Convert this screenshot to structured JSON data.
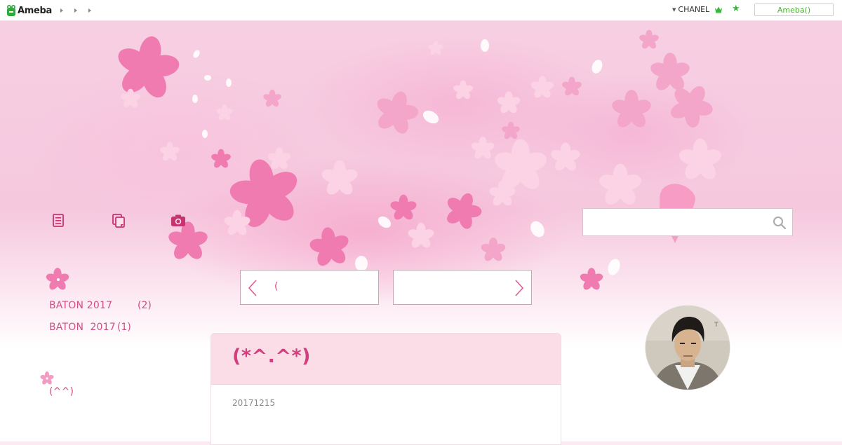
{
  "header": {
    "logo_text": "Ameba",
    "user_name": "CHANEL",
    "ameba_button": "Ameba()"
  },
  "search": {
    "placeholder": ""
  },
  "nav": {
    "pager_prev_label": "(",
    "pager_next_label": ""
  },
  "sidebar": {
    "themes": [
      {
        "label": "BATON 2017",
        "count": "(2)"
      },
      {
        "label": "BATON  2017",
        "count": "(1)"
      }
    ],
    "footer_text": "(^^)"
  },
  "article": {
    "title": "(*^.^*)",
    "date": "20171215"
  },
  "colors": {
    "accent": "#d23f7e",
    "link": "#d04e86",
    "header_bg": "#fadde6",
    "ameba_green": "#3cb53c"
  }
}
